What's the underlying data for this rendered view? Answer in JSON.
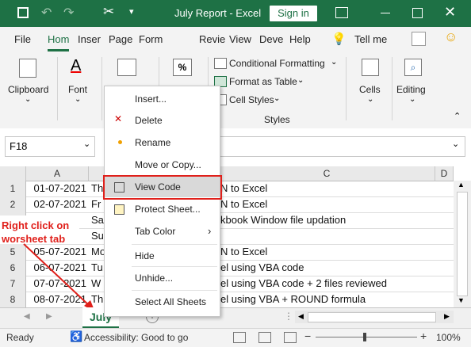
{
  "titlebar": {
    "title": "July Report  -  Excel",
    "signin": "Sign in",
    "colors": {
      "bg": "#1e7145"
    }
  },
  "tabs": [
    "File",
    "Hom",
    "Inser",
    "Page",
    "Form",
    "Revie",
    "View",
    "Deve",
    "Help",
    "Tell me"
  ],
  "ribbon": {
    "clipboard": "Clipboard",
    "font": "Font",
    "cond_format": "Conditional Formatting",
    "format_table": "Format as Table",
    "cell_styles": "Cell Styles",
    "styles_group": "Styles",
    "cells": "Cells",
    "editing": "Editing"
  },
  "namebox": "F18",
  "columns": [
    "A",
    "C",
    "D"
  ],
  "rows": [
    {
      "num": "1",
      "a": "01-07-2021",
      "b": "Th",
      "c": "N to Excel"
    },
    {
      "num": "2",
      "a": "02-07-2021",
      "b": "Fr",
      "c": "N to Excel"
    },
    {
      "num": "3",
      "a": "",
      "b": "Sa",
      "c": "kbook Window file updation"
    },
    {
      "num": "4",
      "a": "",
      "b": "Su",
      "c": ""
    },
    {
      "num": "5",
      "a": "05-07-2021",
      "b": "Mo",
      "c": "N to Excel"
    },
    {
      "num": "6",
      "a": "06-07-2021",
      "b": "Tu",
      "c": "el using VBA code"
    },
    {
      "num": "7",
      "a": "07-07-2021",
      "b": "W",
      "c": "el using VBA code + 2 files reviewed"
    },
    {
      "num": "8",
      "a": "08-07-2021",
      "b": "Th",
      "c": "el using VBA + ROUND formula"
    }
  ],
  "context_menu": [
    "Insert...",
    "Delete",
    "Rename",
    "Move or Copy...",
    "View Code",
    "Protect Sheet...",
    "Tab Color",
    "Hide",
    "Unhide...",
    "Select All Sheets"
  ],
  "annotation": "Right click on worsheet tab",
  "sheet_tab": "July",
  "status": {
    "ready": "Ready",
    "accessibility": "Accessibility: Good to go",
    "zoom": "100%"
  }
}
